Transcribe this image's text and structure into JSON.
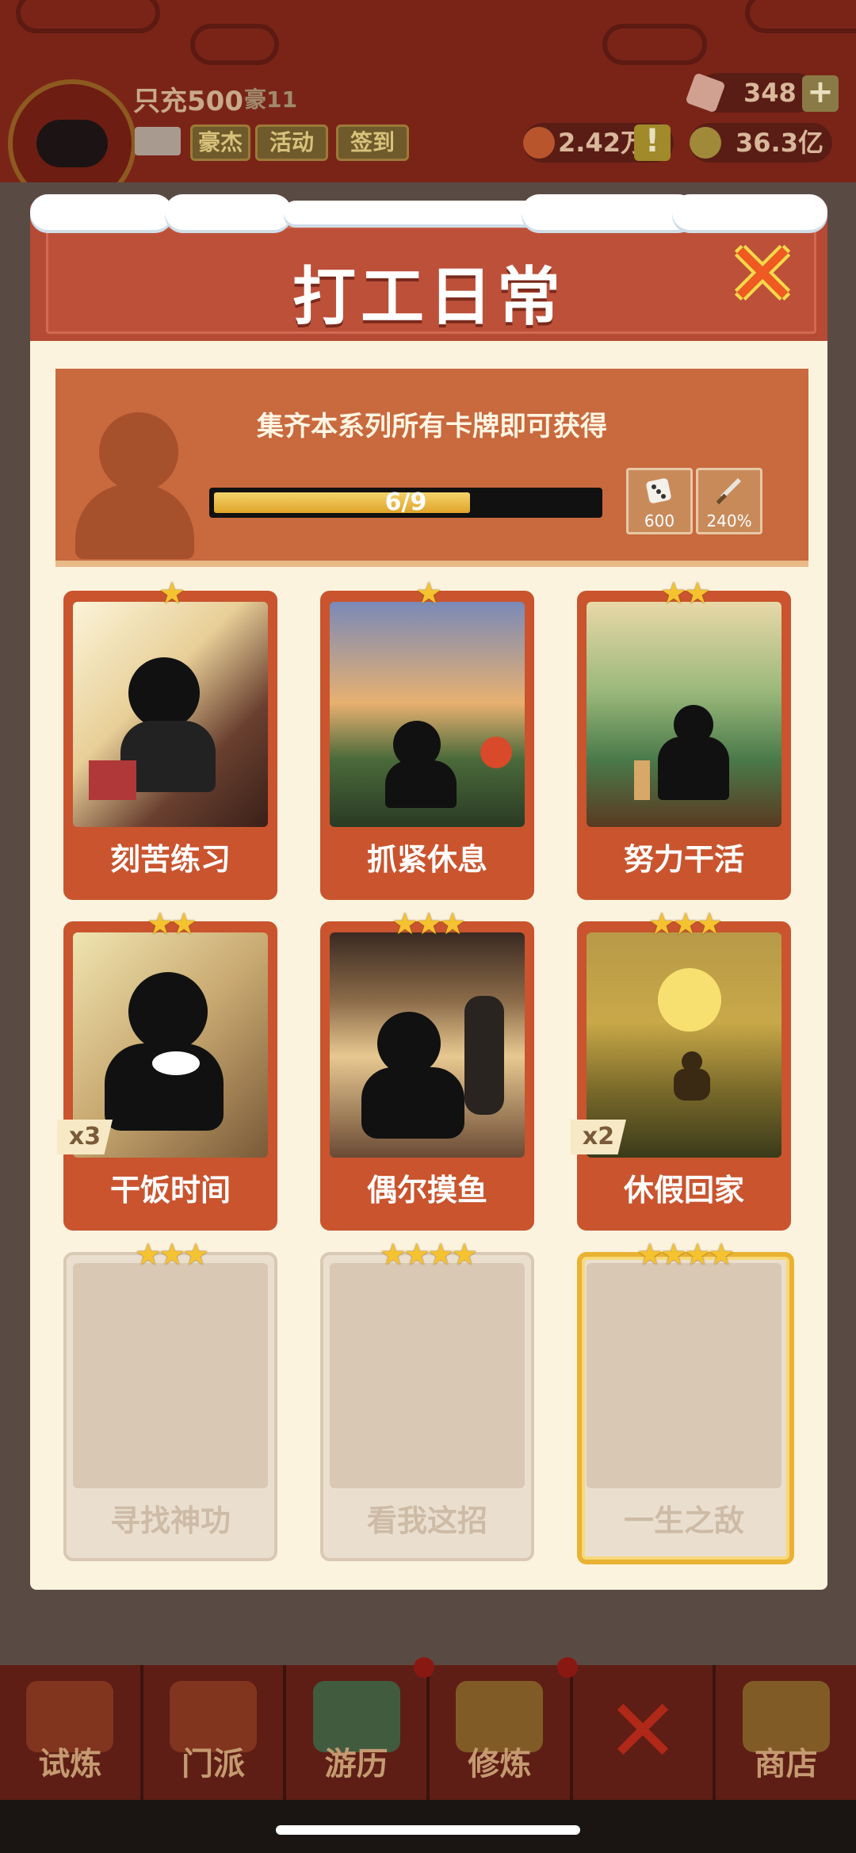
{
  "header": {
    "player_name": "只充500",
    "vip_label": "豪11",
    "buttons": [
      "豪杰",
      "活动",
      "签到"
    ],
    "gems": "348",
    "coupons": "2.42万",
    "gold": "36.3亿"
  },
  "modal": {
    "title": "打工日常",
    "banner_text": "集齐本系列所有卡牌即可获得",
    "progress": {
      "text": "6/9",
      "current": 6,
      "total": 9
    },
    "rewards": [
      {
        "icon": "dice-icon",
        "value": "600"
      },
      {
        "icon": "sword-icon",
        "value": "240%"
      }
    ],
    "cards": [
      {
        "name": "刻苦练习",
        "stars": "★",
        "multiplier": "",
        "collected": true
      },
      {
        "name": "抓紧休息",
        "stars": "★",
        "multiplier": "",
        "collected": true
      },
      {
        "name": "努力干活",
        "stars": "★★",
        "multiplier": "",
        "collected": true
      },
      {
        "name": "干饭时间",
        "stars": "★★",
        "multiplier": "x3",
        "collected": true
      },
      {
        "name": "偶尔摸鱼",
        "stars": "★★★",
        "multiplier": "",
        "collected": true
      },
      {
        "name": "休假回家",
        "stars": "★★★",
        "multiplier": "x2",
        "collected": true
      },
      {
        "name": "寻找神功",
        "stars": "★★★",
        "multiplier": "",
        "collected": false
      },
      {
        "name": "看我这招",
        "stars": "★★★★",
        "multiplier": "",
        "collected": false
      },
      {
        "name": "一生之敌",
        "stars": "★★★★",
        "multiplier": "",
        "collected": false
      }
    ]
  },
  "bottom_nav": {
    "items": [
      "试炼",
      "门派",
      "游历",
      "修炼",
      "",
      "商店"
    ]
  },
  "colors": {
    "modal_header": "#b54a35",
    "card_frame": "#c9542e",
    "star": "#f5c230",
    "modal_bg": "#fbf3de"
  }
}
